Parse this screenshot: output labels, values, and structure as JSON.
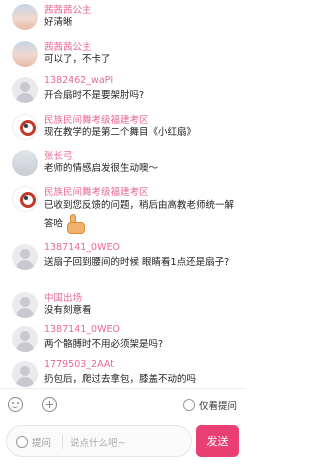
{
  "messages": [
    {
      "name": "茜茜茜公主",
      "text": "好清晰"
    },
    {
      "name": "茜茜茜公主",
      "text": "可以了，不卡了"
    },
    {
      "name": "1382462_waPI",
      "text": "开合扇时不是要架肘吗?"
    },
    {
      "name": "民族民间舞考级福建考区",
      "text": "现在教学的是第二个舞目《小红扇》"
    },
    {
      "name": "张长弓",
      "text": "老师的情感启发很生动噢～"
    },
    {
      "name": "民族民间舞考级福建考区",
      "text": "已收到您反馈的问题，稍后由高教老师统一解答哈"
    },
    {
      "name": "1387141_0WEO",
      "text": "送扇子回到腰间的时候 眼睛看1点还是扇子?"
    },
    {
      "name": "中国出场",
      "text": "没有刻意看"
    },
    {
      "name": "1387141_0WEO",
      "text": "两个骼膊时不用必须架是吗?"
    },
    {
      "name": "1779503_2AAt",
      "text": "扔包后，爬过去拿包，膝盖不动的吗"
    }
  ],
  "toolbar": {
    "only_teacher_label": "仅看提问"
  },
  "input": {
    "question_label": "提问",
    "placeholder": "说点什么吧~",
    "send_label": "发送"
  },
  "colors": {
    "accent": "#ea3f73",
    "username": "#e8689a"
  }
}
